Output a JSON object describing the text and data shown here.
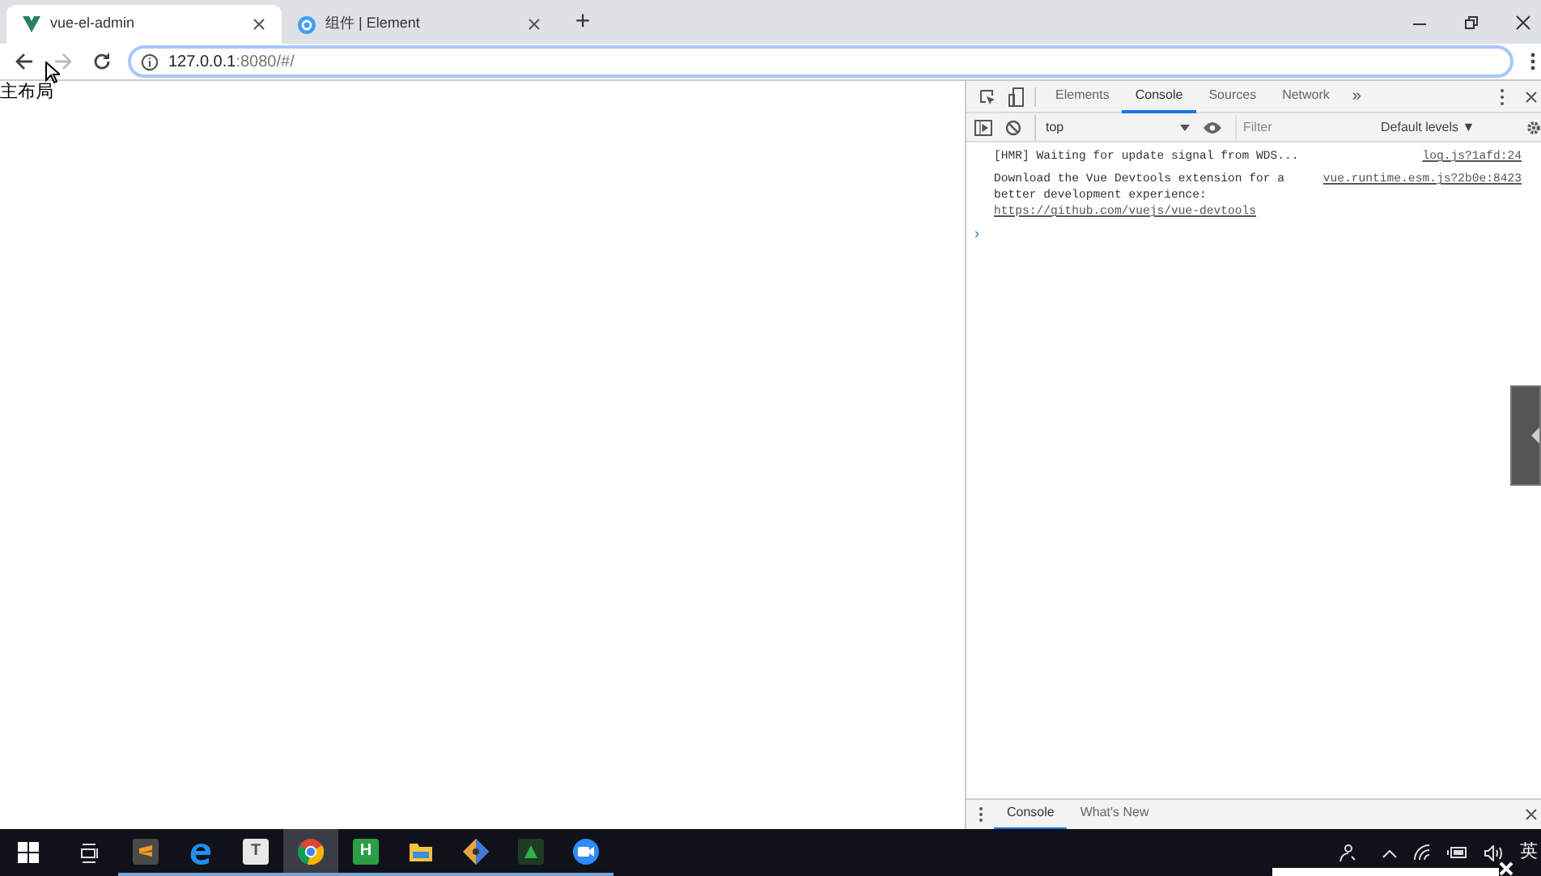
{
  "browser_tabs": [
    {
      "title": "vue-el-admin",
      "selected": true,
      "kind": "vue"
    },
    {
      "title": "组件 | Element",
      "selected": false,
      "kind": "element"
    }
  ],
  "new_tab": "+",
  "nav_buttons": [
    {
      "kind": "back",
      "disabled": false
    },
    {
      "kind": "forward",
      "disabled": true
    },
    {
      "kind": "reload",
      "disabled": false
    }
  ],
  "address_bar": {
    "host": "127.0.0.1",
    "path": ":8080/#/"
  },
  "page": {
    "heading": "主布局"
  },
  "devtools": {
    "tabs": [
      {
        "label": "Elements",
        "selected": false
      },
      {
        "label": "Console",
        "selected": true
      },
      {
        "label": "Sources",
        "selected": false
      },
      {
        "label": "Network",
        "selected": false
      }
    ],
    "more": "»",
    "context": "top",
    "filter": {
      "placeholder": "Filter"
    },
    "levels": "Default levels ▼",
    "messages": [
      {
        "text": "[HMR] Waiting for update signal from WDS...",
        "source": "log.js?1afd:24"
      },
      {
        "text": "Download the Vue Devtools extension for a better development experience:",
        "link": "https://github.com/vuejs/vue-devtools",
        "source": "vue.runtime.esm.js?2b0e:8423"
      }
    ],
    "prompt": "›",
    "drawer_tabs": [
      {
        "label": "Console",
        "selected": true
      },
      {
        "label": "What's New",
        "selected": false
      }
    ]
  },
  "taskbar": {
    "apps": [
      {
        "kind": "sublime",
        "active": false
      },
      {
        "kind": "edge",
        "active": false
      },
      {
        "kind": "typora",
        "glyph": "T",
        "active": false
      },
      {
        "kind": "chrome",
        "active": true
      },
      {
        "kind": "hbuilder",
        "glyph": "H",
        "active": false
      },
      {
        "kind": "explorer",
        "active": false
      },
      {
        "kind": "git",
        "active": false
      },
      {
        "kind": "terminal",
        "active": false
      },
      {
        "kind": "camera",
        "active": false
      }
    ],
    "input_method": "英"
  }
}
